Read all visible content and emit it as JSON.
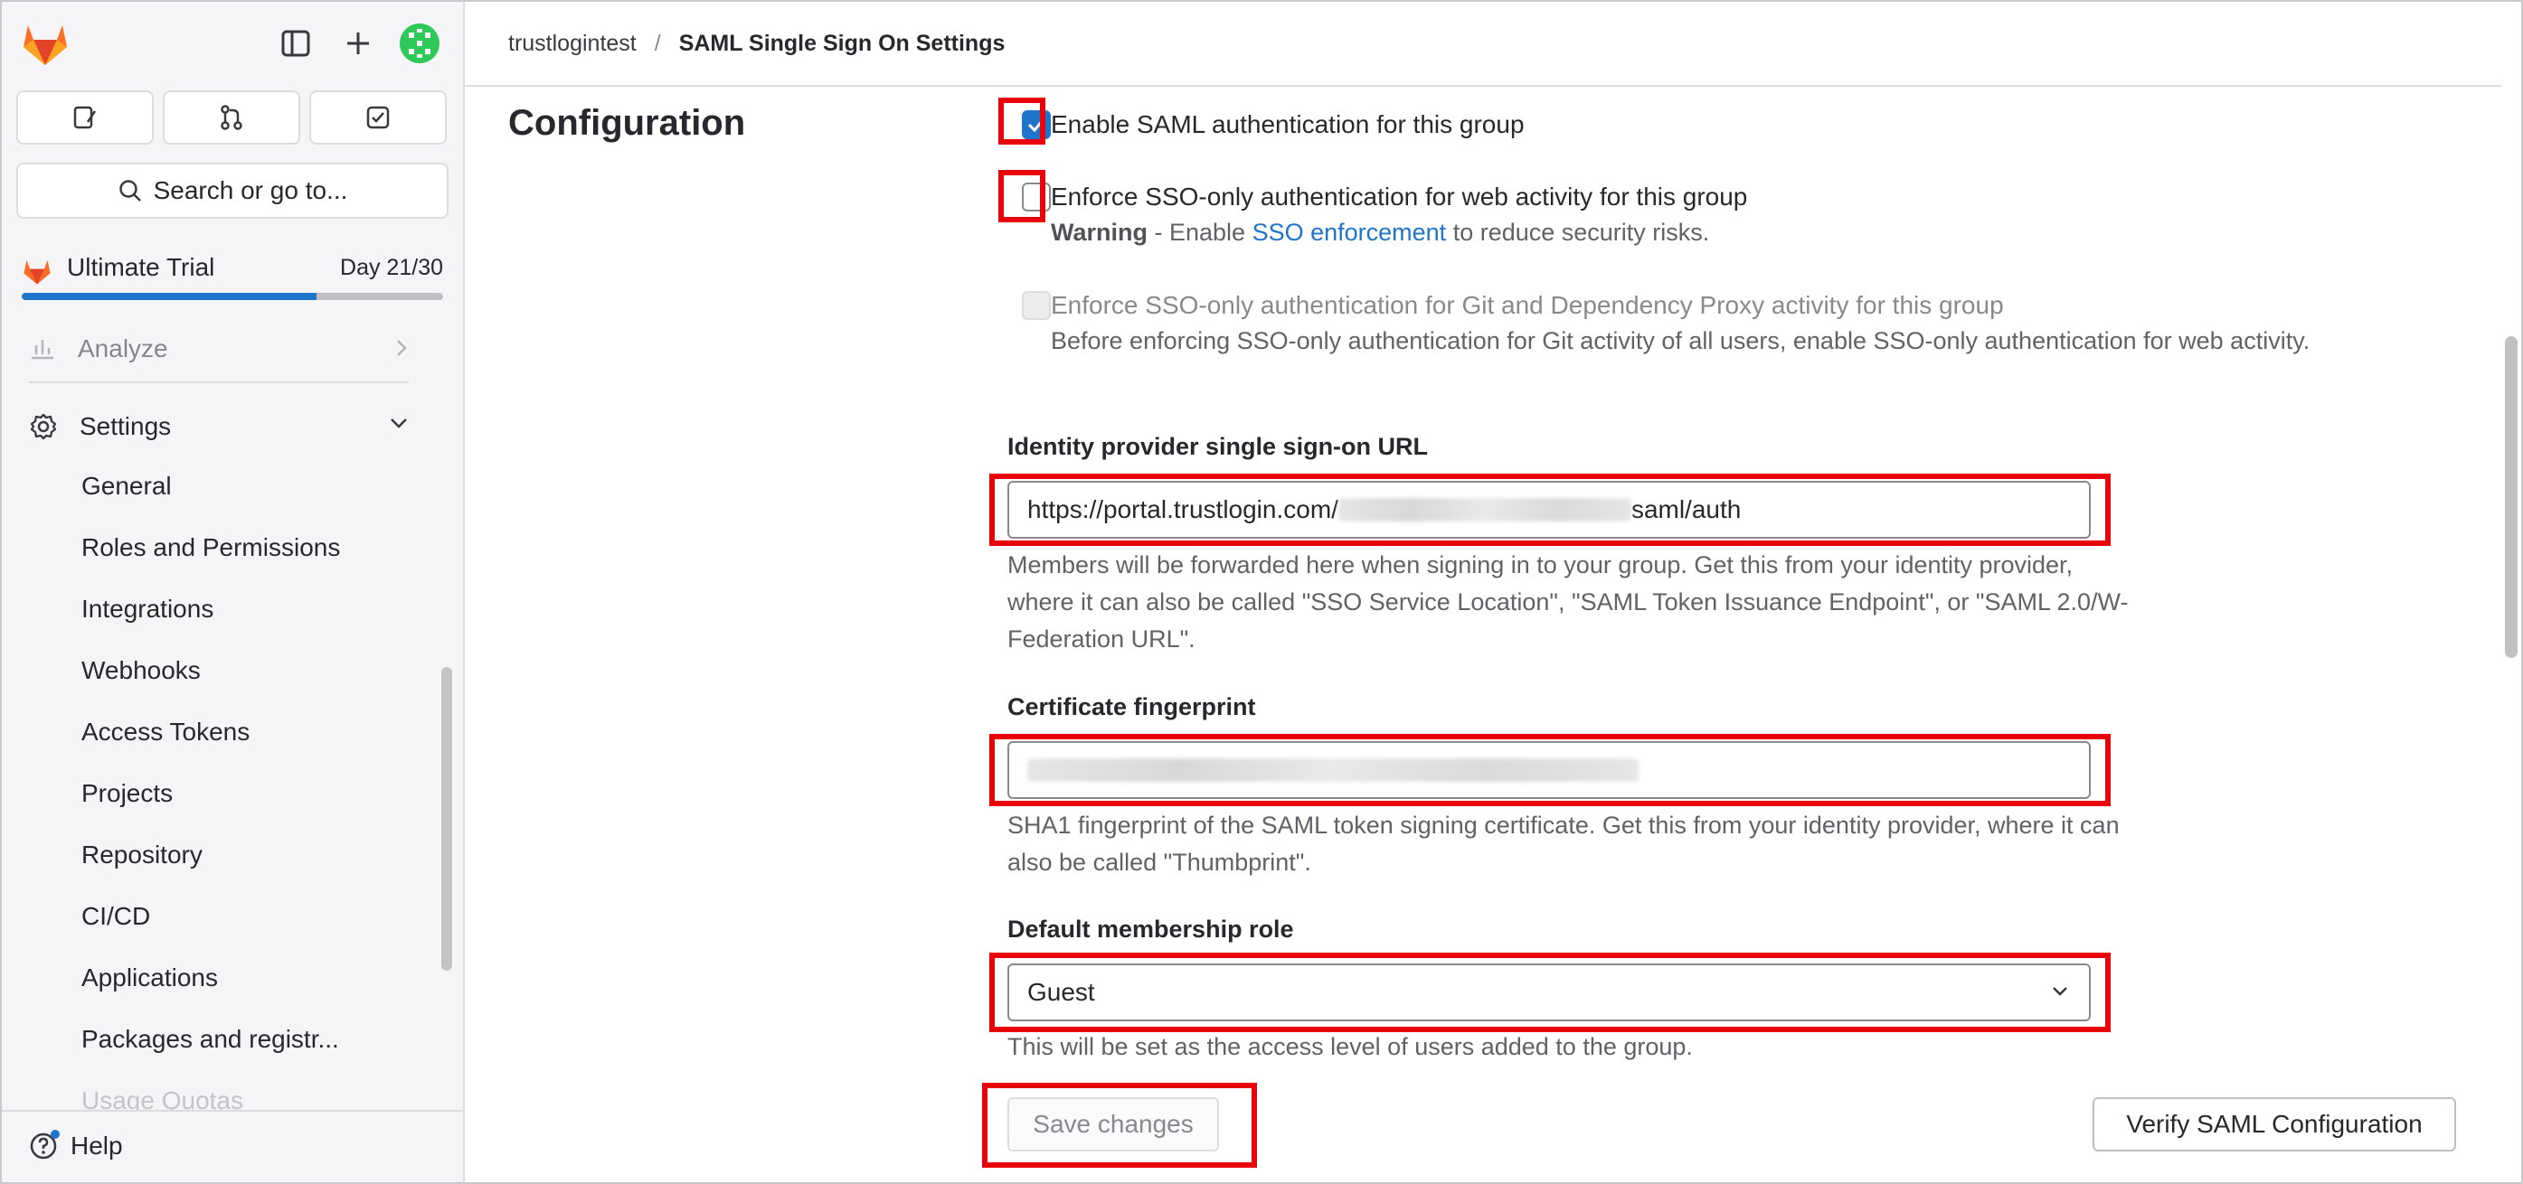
{
  "sidebar": {
    "quick_actions": [
      "issues-icon",
      "merge-requests-icon",
      "todos-icon"
    ],
    "search_label": "Search or go to...",
    "trial": {
      "name": "Ultimate Trial",
      "day": "Day 21/30",
      "progress": 0.7
    },
    "nav": {
      "analyze": "Analyze",
      "settings": "Settings",
      "settings_items": [
        "General",
        "Roles and Permissions",
        "Integrations",
        "Webhooks",
        "Access Tokens",
        "Projects",
        "Repository",
        "CI/CD",
        "Applications",
        "Packages and registr...",
        "Usage Quotas"
      ]
    },
    "help": "Help"
  },
  "breadcrumb": {
    "group": "trustlogintest",
    "separator": "/",
    "current": "SAML Single Sign On Settings"
  },
  "section_title": "Configuration",
  "form": {
    "enable_saml": {
      "label": "Enable SAML authentication for this group",
      "checked": true
    },
    "enforce_sso_web": {
      "label": "Enforce SSO-only authentication for web activity for this group",
      "checked": false,
      "warning_bold": "Warning",
      "warning_prefix": " - Enable ",
      "warning_link": "SSO enforcement",
      "warning_suffix": " to reduce security risks."
    },
    "enforce_sso_git": {
      "label": "Enforce SSO-only authentication for Git and Dependency Proxy activity for this group",
      "checked": false,
      "disabled": true,
      "help": "Before enforcing SSO-only authentication for Git activity of all users, enable SSO-only authentication for web activity."
    },
    "idp_url": {
      "label": "Identity provider single sign-on URL",
      "value_prefix": "https://portal.trustlogin.com/",
      "value_suffix": "saml/auth",
      "help": "Members will be forwarded here when signing in to your group. Get this from your identity provider, where it can also be called \"SSO Service Location\", \"SAML Token Issuance Endpoint\", or \"SAML 2.0/W-Federation URL\"."
    },
    "cert_fingerprint": {
      "label": "Certificate fingerprint",
      "help": "SHA1 fingerprint of the SAML token signing certificate. Get this from your identity provider, where it can also be called \"Thumbprint\"."
    },
    "membership_role": {
      "label": "Default membership role",
      "selected": "Guest",
      "help": "This will be set as the access level of users added to the group."
    },
    "save_label": "Save changes",
    "verify_label": "Verify SAML Configuration"
  },
  "colors": {
    "accent": "#1f75cb",
    "highlight": "#e8000b",
    "logo": "#e24329"
  }
}
